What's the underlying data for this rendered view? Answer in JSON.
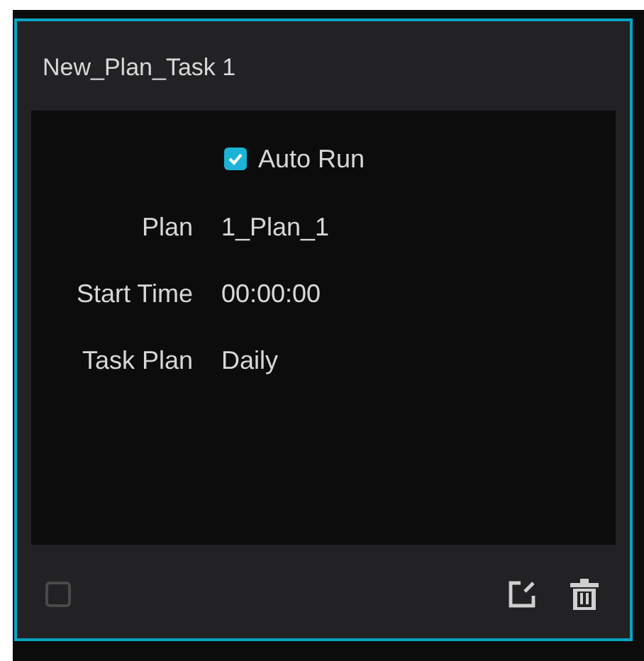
{
  "card": {
    "title": "New_Plan_Task 1",
    "auto_run": {
      "label": "Auto Run",
      "checked": true
    },
    "fields": [
      {
        "label": "Plan",
        "value": "1_Plan_1"
      },
      {
        "label": "Start Time",
        "value": "00:00:00"
      },
      {
        "label": "Task Plan",
        "value": "Daily"
      }
    ],
    "select": {
      "checked": false
    }
  }
}
